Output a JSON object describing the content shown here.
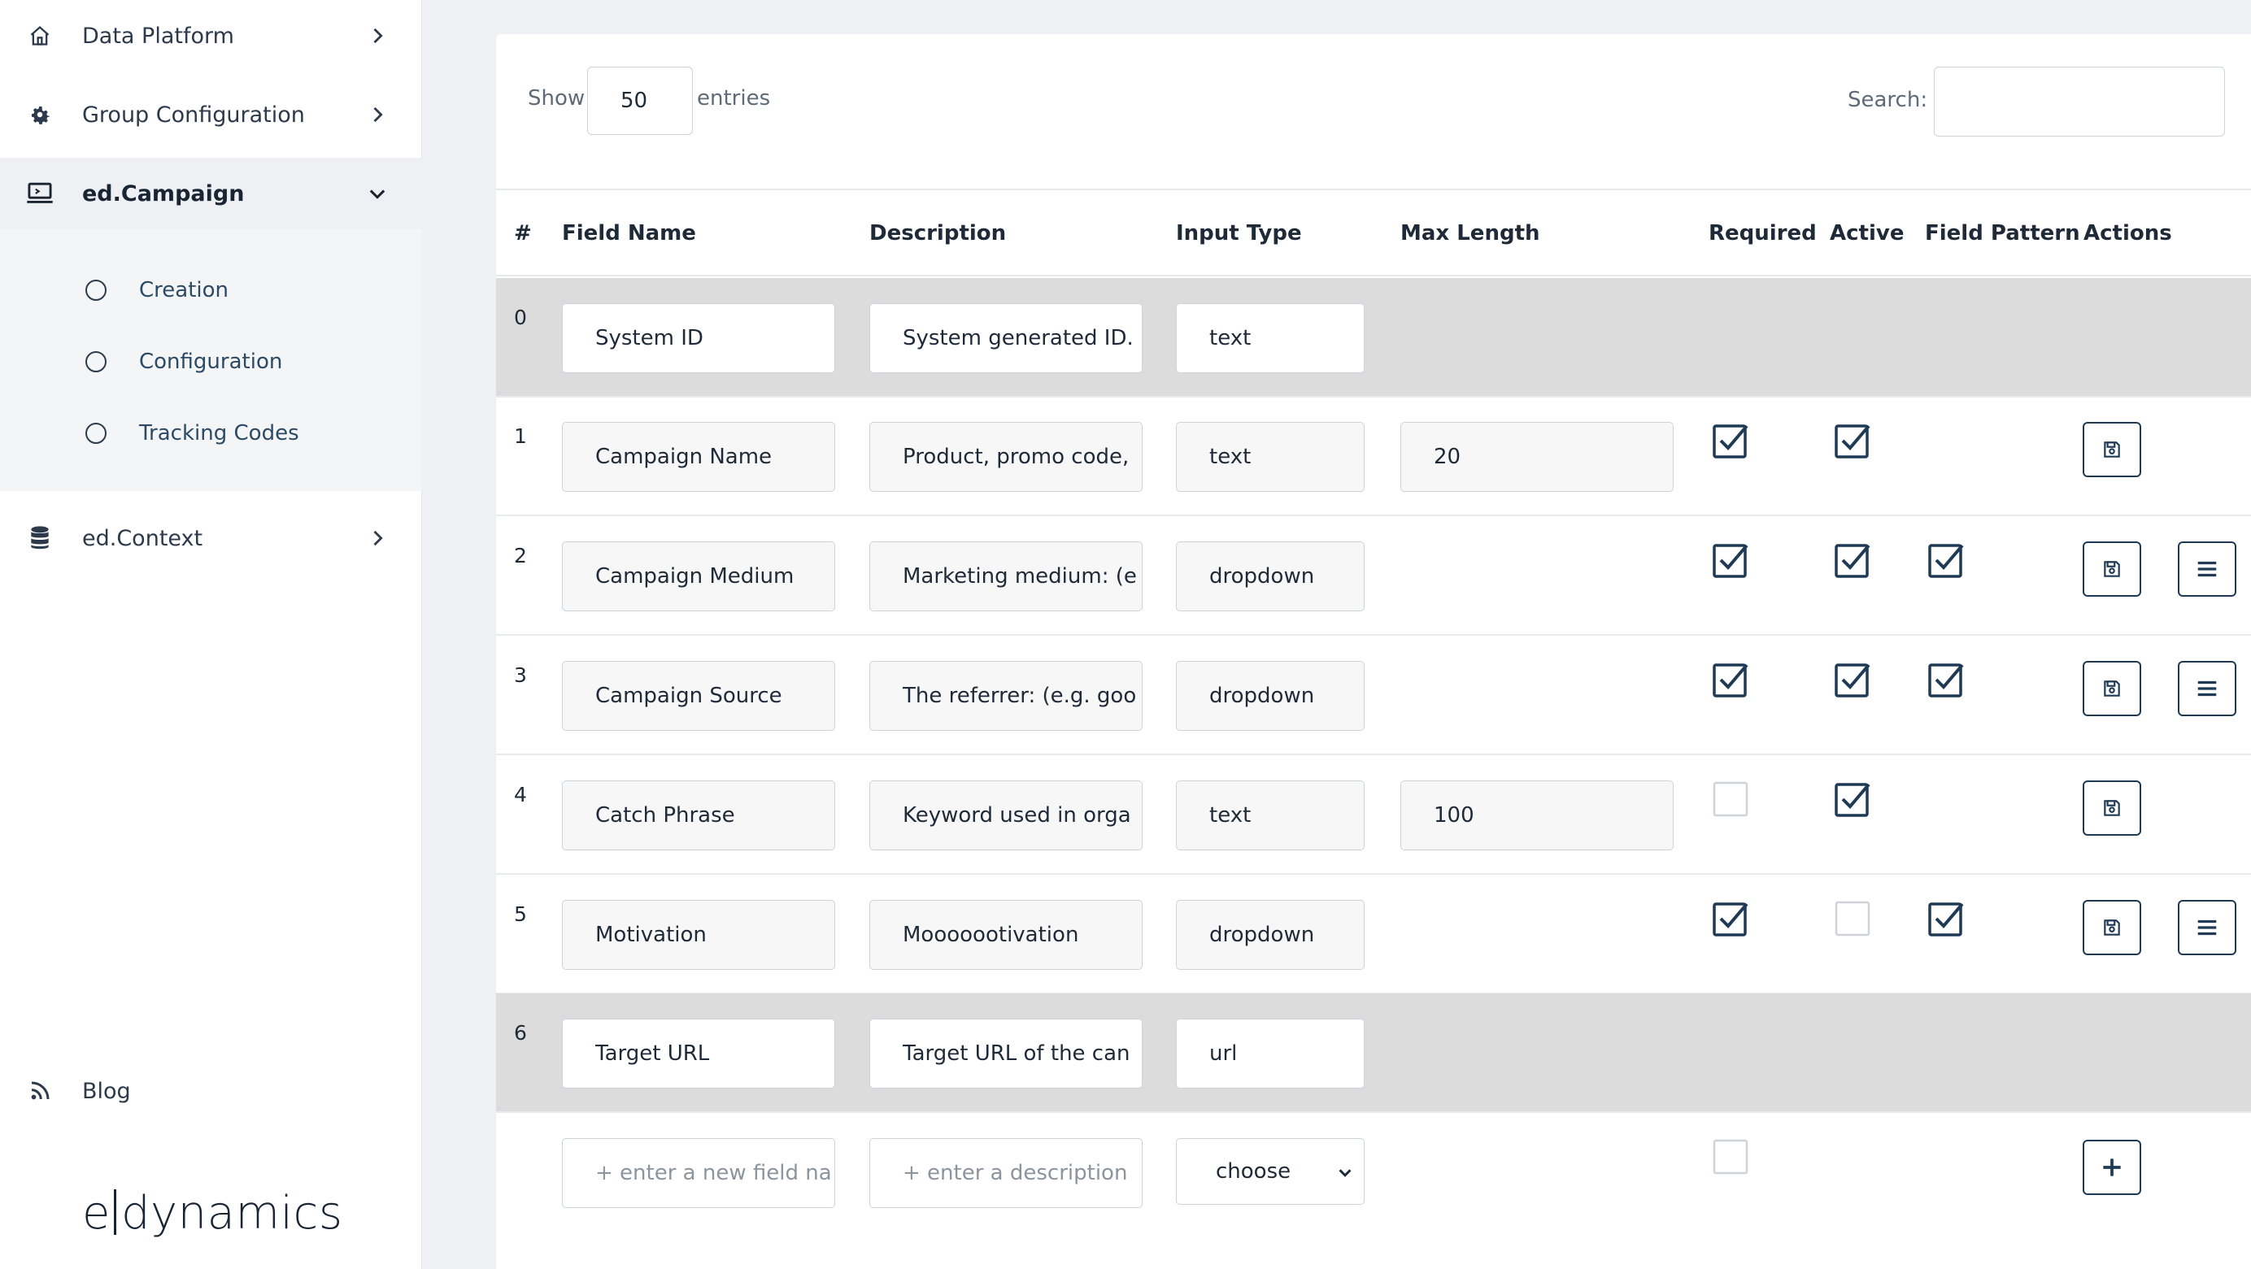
{
  "sidebar": {
    "items": [
      {
        "label": "Data Platform",
        "icon": "home-icon"
      },
      {
        "label": "Group Configuration",
        "icon": "gear-icon"
      },
      {
        "label": "ed.Campaign",
        "icon": "laptop-icon",
        "expanded": true
      },
      {
        "label": "ed.Context",
        "icon": "database-icon"
      },
      {
        "label": "Blog",
        "icon": "rss-icon"
      }
    ],
    "subitems": [
      {
        "label": "Creation"
      },
      {
        "label": "Configuration"
      },
      {
        "label": "Tracking Codes"
      }
    ],
    "logo": {
      "left": "e",
      "right": "dynamics"
    }
  },
  "toolbar": {
    "show_label": "Show",
    "entries_value": "50",
    "entries_label": "entries",
    "search_label": "Search:",
    "search_value": ""
  },
  "table": {
    "headers": [
      "#",
      "Field Name",
      "Description",
      "Input Type",
      "Max Length",
      "Required",
      "Active",
      "Field Pattern",
      "Actions"
    ],
    "rows": [
      {
        "num": "0",
        "field": "System ID",
        "desc": "System generated ID.",
        "type": "text",
        "max": "",
        "required": null,
        "active": null,
        "pattern": null,
        "save": false,
        "list": false,
        "gray": true
      },
      {
        "num": "1",
        "field": "Campaign Name",
        "desc": "Product, promo code,",
        "type": "text",
        "max": "20",
        "required": true,
        "active": true,
        "pattern": null,
        "save": true,
        "list": false,
        "gray": false
      },
      {
        "num": "2",
        "field": "Campaign Medium",
        "desc": "Marketing medium: (e",
        "type": "dropdown",
        "max": "",
        "required": true,
        "active": true,
        "pattern": true,
        "save": true,
        "list": true,
        "gray": false
      },
      {
        "num": "3",
        "field": "Campaign Source",
        "desc": "The referrer: (e.g. goo",
        "type": "dropdown",
        "max": "",
        "required": true,
        "active": true,
        "pattern": true,
        "save": true,
        "list": true,
        "gray": false
      },
      {
        "num": "4",
        "field": "Catch Phrase",
        "desc": "Keyword used in orga",
        "type": "text",
        "max": "100",
        "required": false,
        "active": true,
        "pattern": null,
        "save": true,
        "list": false,
        "gray": false
      },
      {
        "num": "5",
        "field": "Motivation",
        "desc": "Mooooootivation",
        "type": "dropdown",
        "max": "",
        "required": true,
        "active": false,
        "pattern": true,
        "save": true,
        "list": true,
        "gray": false
      },
      {
        "num": "6",
        "field": "Target URL",
        "desc": "Target URL of the can",
        "type": "url",
        "max": "",
        "required": null,
        "active": null,
        "pattern": null,
        "save": false,
        "list": false,
        "gray": true
      }
    ],
    "new_row": {
      "field_placeholder": "+ enter a new field na",
      "desc_placeholder": "+ enter a description",
      "type_value": "choose"
    }
  },
  "colors": {
    "accent": "#1f3a55",
    "row_gray": "#dcdcdc",
    "sidebar_active": "#eef0f3"
  }
}
